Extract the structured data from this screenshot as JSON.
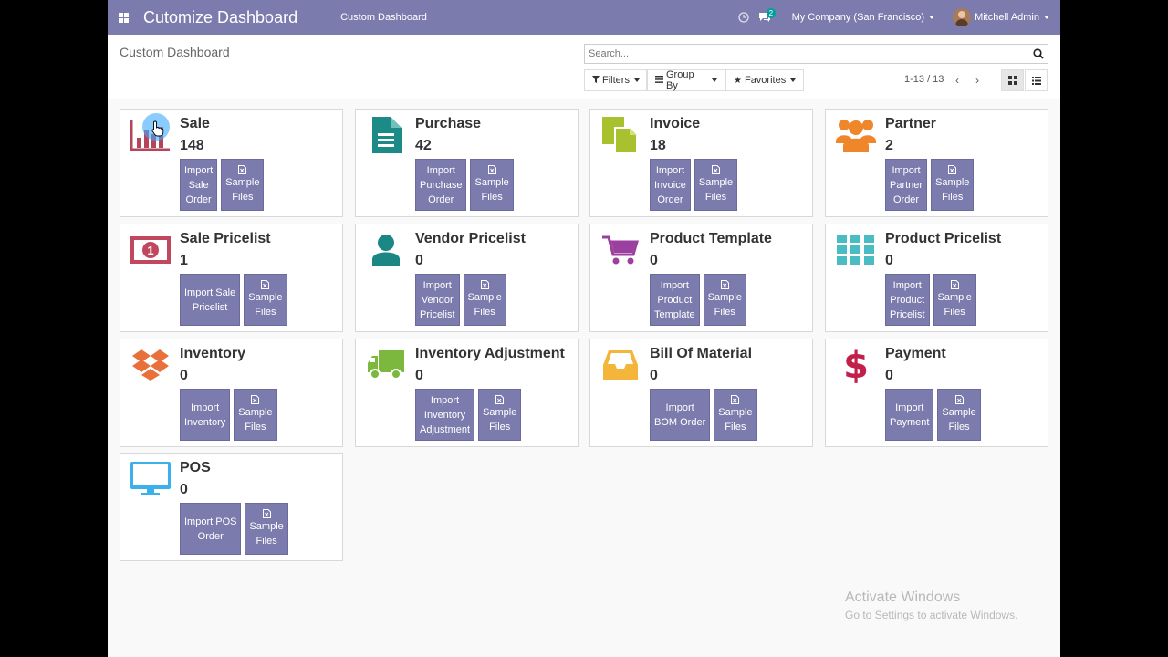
{
  "navbar": {
    "brand": "Cutomize Dashboard",
    "menu": "Custom Dashboard",
    "chat_badge": "2",
    "company": "My Company (San Francisco)",
    "user": "Mitchell Admin"
  },
  "control": {
    "breadcrumb": "Custom Dashboard",
    "search_placeholder": "Search...",
    "filters": "Filters",
    "group_by": "Group By",
    "favorites": "Favorites",
    "pager": "1-13 / 13"
  },
  "colors": {
    "navbar": "#7c7bad",
    "button": "#7c7bad"
  },
  "cards": [
    {
      "title": "Sale",
      "count": "148",
      "icon": "sale-chart-icon",
      "btn1": [
        "Import",
        "Sale",
        "Order"
      ],
      "btn2": [
        "Sample",
        "Files"
      ]
    },
    {
      "title": "Purchase",
      "count": "42",
      "icon": "purchase-file-icon",
      "btn1": [
        "Import",
        "Purchase",
        "Order"
      ],
      "btn2": [
        "Sample",
        "Files"
      ]
    },
    {
      "title": "Invoice",
      "count": "18",
      "icon": "invoice-copy-icon",
      "btn1": [
        "Import",
        "Invoice",
        "Order"
      ],
      "btn2": [
        "Sample",
        "Files"
      ]
    },
    {
      "title": "Partner",
      "count": "2",
      "icon": "partner-users-icon",
      "btn1": [
        "Import",
        "Partner",
        "Order"
      ],
      "btn2": [
        "Sample",
        "Files"
      ]
    },
    {
      "title": "Sale Pricelist",
      "count": "1",
      "icon": "money-bill-icon",
      "btn1": [
        "Import Sale",
        "Pricelist"
      ],
      "btn2": [
        "Sample",
        "Files"
      ]
    },
    {
      "title": "Vendor Pricelist",
      "count": "0",
      "icon": "vendor-user-icon",
      "btn1": [
        "Import",
        "Vendor",
        "Pricelist"
      ],
      "btn2": [
        "Sample",
        "Files"
      ]
    },
    {
      "title": "Product Template",
      "count": "0",
      "icon": "shopping-cart-icon",
      "btn1": [
        "Import",
        "Product",
        "Template"
      ],
      "btn2": [
        "Sample",
        "Files"
      ]
    },
    {
      "title": "Product Pricelist",
      "count": "0",
      "icon": "grid-icon",
      "btn1": [
        "Import",
        "Product",
        "Pricelist"
      ],
      "btn2": [
        "Sample",
        "Files"
      ]
    },
    {
      "title": "Inventory",
      "count": "0",
      "icon": "dropbox-icon",
      "btn1": [
        "Import",
        "Inventory"
      ],
      "btn2": [
        "Sample",
        "Files"
      ]
    },
    {
      "title": "Inventory Adjustment",
      "count": "0",
      "icon": "truck-icon",
      "btn1": [
        "Import",
        "Inventory",
        "Adjustment"
      ],
      "btn2": [
        "Sample",
        "Files"
      ]
    },
    {
      "title": "Bill Of Material",
      "count": "0",
      "icon": "inbox-tray-icon",
      "btn1": [
        "Import",
        "BOM Order"
      ],
      "btn2": [
        "Sample",
        "Files"
      ]
    },
    {
      "title": "Payment",
      "count": "0",
      "icon": "dollar-icon",
      "btn1": [
        "Import",
        "Payment"
      ],
      "btn2": [
        "Sample",
        "Files"
      ]
    },
    {
      "title": "POS",
      "count": "0",
      "icon": "monitor-icon",
      "btn1": [
        "Import POS",
        "Order"
      ],
      "btn2": [
        "Sample",
        "Files"
      ]
    }
  ],
  "watermark": {
    "line1": "Activate Windows",
    "line2": "Go to Settings to activate Windows."
  }
}
